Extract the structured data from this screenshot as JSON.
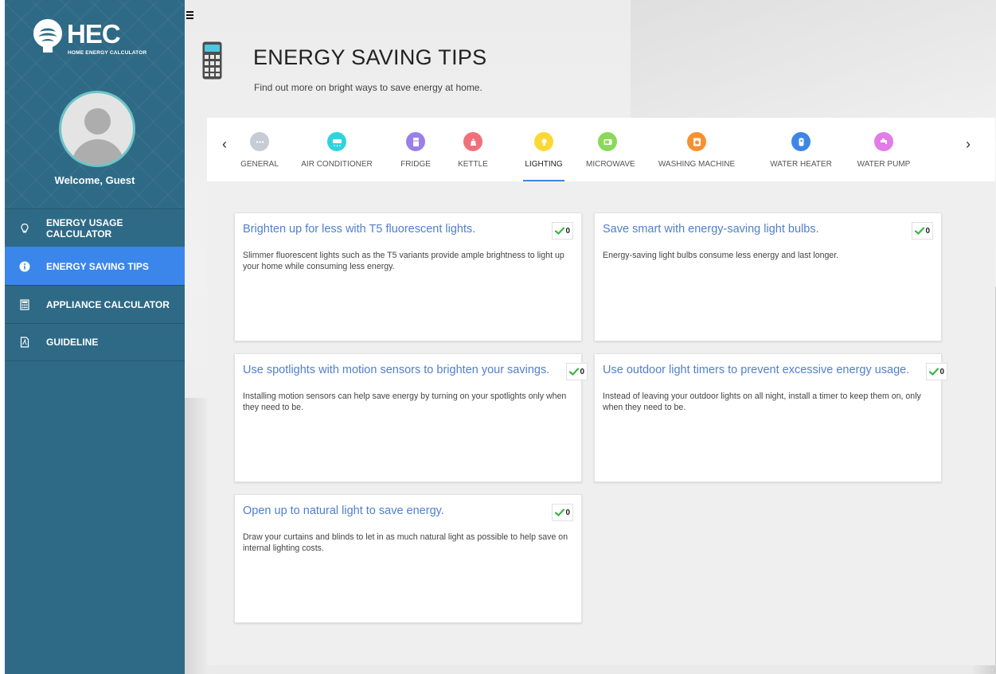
{
  "sidebar": {
    "logo_title": "HEC",
    "logo_subtitle": "HOME ENERGY CALCULATOR",
    "welcome": "Welcome, Guest",
    "items": [
      {
        "label": "ENERGY USAGE CALCULATOR",
        "icon": "lightbulb-icon",
        "active": false
      },
      {
        "label": "ENERGY SAVING TIPS",
        "icon": "info-icon",
        "active": true
      },
      {
        "label": "APPLIANCE CALCULATOR",
        "icon": "calculator-icon",
        "active": false
      },
      {
        "label": "GUIDELINE",
        "icon": "document-icon",
        "active": false
      }
    ]
  },
  "header": {
    "title": "ENERGY SAVING TIPS",
    "subtitle": "Find out more on bright ways to save energy at home."
  },
  "tabs": [
    {
      "label": "GENERAL",
      "icon": "more-icon",
      "color": "#c5ccd4"
    },
    {
      "label": "AIR CONDITIONER",
      "icon": "air-conditioner-icon",
      "color": "#2fd3df"
    },
    {
      "label": "FRIDGE",
      "icon": "fridge-icon",
      "color": "#9b7fe6"
    },
    {
      "label": "KETTLE",
      "icon": "kettle-icon",
      "color": "#f0707a"
    },
    {
      "label": "LIGHTING",
      "icon": "lightbulb-icon",
      "color": "#fdd835"
    },
    {
      "label": "MICROWAVE",
      "icon": "microwave-icon",
      "color": "#8bd85b"
    },
    {
      "label": "WASHING MACHINE",
      "icon": "washing-machine-icon",
      "color": "#f7902f"
    },
    {
      "label": "WATER HEATER",
      "icon": "water-heater-icon",
      "color": "#3d86e6"
    },
    {
      "label": "WATER PUMP",
      "icon": "water-pump-icon",
      "color": "#e27ce8"
    }
  ],
  "active_tab": "LIGHTING",
  "tips": [
    {
      "title": "Brighten up for less with T5 fluorescent lights.",
      "body": "Slimmer fluorescent lights such as the T5 variants provide ample brightness to light up your home while consuming less energy.",
      "votes": "0"
    },
    {
      "title": "Save smart with energy-saving light bulbs.",
      "body": "Energy-saving light bulbs consume less energy and last longer.",
      "votes": "0"
    },
    {
      "title": "Use spotlights with motion sensors to brighten your savings.",
      "body": "Installing motion sensors can help save energy by turning on your spotlights only when they need to be.",
      "votes": "0"
    },
    {
      "title": "Use outdoor light timers to prevent excessive energy usage.",
      "body": "Instead of leaving your outdoor lights on all night, install a timer to keep them on, only when they need to be.",
      "votes": "0"
    },
    {
      "title": "Open up to natural light to save energy.",
      "body": "Draw your curtains and blinds to let in as much natural light as possible to help save on internal lighting costs.",
      "votes": "0"
    }
  ],
  "colors": {
    "sidebar": "#2e6a86",
    "active_nav": "#3b86ea",
    "tip_title": "#4f7fcf",
    "check": "#3cb54a"
  }
}
